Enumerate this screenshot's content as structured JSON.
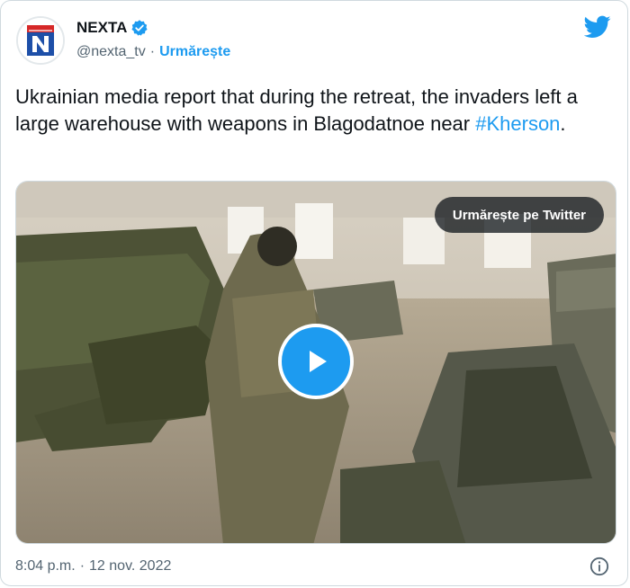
{
  "author": {
    "name": "NEXTA",
    "handle": "@nexta_tv",
    "separator": "·",
    "follow_label": "Urmărește"
  },
  "tweet": {
    "text_before": "Ukrainian media report that during the retreat, the invaders left a large warehouse with weapons in Blagodatnoe near ",
    "hashtag": "#Kherson",
    "text_after": "."
  },
  "media": {
    "watch_label": "Urmărește pe Twitter"
  },
  "footer": {
    "time": "8:04 p.m.",
    "separator": "·",
    "date": "12 nov. 2022"
  },
  "icons": {
    "verified": "verified-badge-icon",
    "twitter": "twitter-bird-icon",
    "play": "play-icon",
    "info": "info-icon"
  },
  "colors": {
    "accent": "#1d9bf0",
    "text": "#0f1419",
    "muted": "#536471",
    "brand_red": "#d62828"
  }
}
